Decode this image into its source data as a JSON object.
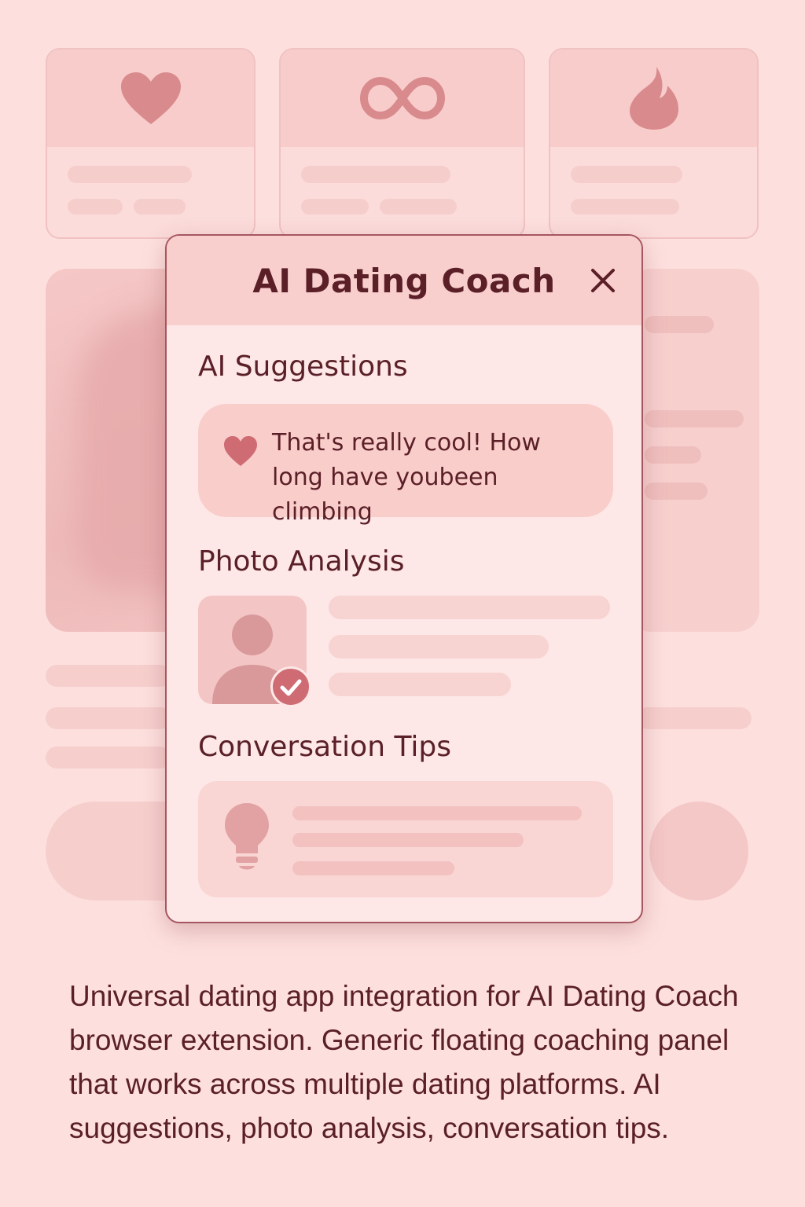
{
  "app_cards": [
    {
      "icon": "heart-icon"
    },
    {
      "icon": "infinity-icon"
    },
    {
      "icon": "flame-icon"
    }
  ],
  "panel": {
    "title": "AI Dating Coach",
    "close_icon": "close-icon",
    "sections": {
      "suggestions": {
        "title": "AI Suggestions",
        "icon": "heart-icon",
        "text": "That's really cool! How\nlong have youbeen climbing"
      },
      "photo_analysis": {
        "title": "Photo Analysis",
        "icon": "person-icon",
        "badge_icon": "check-icon"
      },
      "conversation_tips": {
        "title": "Conversation Tips",
        "icon": "lightbulb-icon"
      }
    }
  },
  "caption": "Universal dating app integration for AI Dating Coach browser extension. Generic floating coaching panel that works across multiple dating platforms. AI suggestions, photo analysis, conversation tips.",
  "colors": {
    "background": "#fde0de",
    "panel_border": "#a65660",
    "accent": "#cf6b73",
    "text": "#5a1f27"
  }
}
